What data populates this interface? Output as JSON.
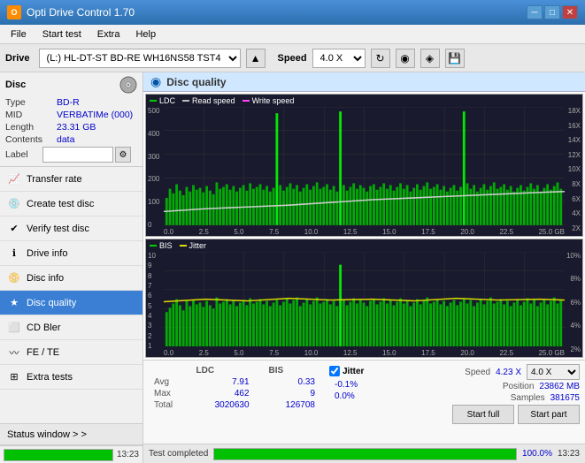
{
  "titlebar": {
    "title": "Opti Drive Control 1.70",
    "icon_label": "O",
    "btn_min": "─",
    "btn_max": "□",
    "btn_close": "✕"
  },
  "menubar": {
    "items": [
      {
        "label": "File"
      },
      {
        "label": "Start test"
      },
      {
        "label": "Extra"
      },
      {
        "label": "Help"
      }
    ]
  },
  "toolbar": {
    "drive_label": "Drive",
    "drive_value": "(L:)  HL-DT-ST BD-RE  WH16NS58 TST4",
    "speed_label": "Speed",
    "speed_value": "4.0 X"
  },
  "disc": {
    "title": "Disc",
    "type_label": "Type",
    "type_value": "BD-R",
    "mid_label": "MID",
    "mid_value": "VERBATIMe (000)",
    "length_label": "Length",
    "length_value": "23.31 GB",
    "contents_label": "Contents",
    "contents_value": "data",
    "label_label": "Label",
    "label_value": ""
  },
  "nav": {
    "items": [
      {
        "id": "transfer-rate",
        "label": "Transfer rate",
        "icon": "chart"
      },
      {
        "id": "create-test-disc",
        "label": "Create test disc",
        "icon": "disc"
      },
      {
        "id": "verify-test-disc",
        "label": "Verify test disc",
        "icon": "check"
      },
      {
        "id": "drive-info",
        "label": "Drive info",
        "icon": "info"
      },
      {
        "id": "disc-info",
        "label": "Disc info",
        "icon": "disc2"
      },
      {
        "id": "disc-quality",
        "label": "Disc quality",
        "icon": "quality",
        "active": true
      },
      {
        "id": "cd-bler",
        "label": "CD Bler",
        "icon": "cd"
      },
      {
        "id": "fe-te",
        "label": "FE / TE",
        "icon": "fe"
      },
      {
        "id": "extra-tests",
        "label": "Extra tests",
        "icon": "extra"
      }
    ]
  },
  "chart": {
    "title": "Disc quality",
    "ldc_legend": "LDC",
    "read_legend": "Read speed",
    "write_legend": "Write speed",
    "bis_legend": "BIS",
    "jitter_legend": "Jitter",
    "x_max": "25.0",
    "y1_max": "500",
    "y2_max": "10",
    "colors": {
      "ldc": "#00aa00",
      "read": "#aaaaaa",
      "write": "#ff00ff",
      "bis": "#00aa00",
      "jitter": "#dddd00",
      "bg": "#1a1a2e"
    }
  },
  "stats": {
    "ldc_label": "LDC",
    "bis_label": "BIS",
    "jitter_label": "Jitter",
    "speed_label": "Speed",
    "position_label": "Position",
    "samples_label": "Samples",
    "avg_label": "Avg",
    "max_label": "Max",
    "total_label": "Total",
    "avg_ldc": "7.91",
    "avg_bis": "0.33",
    "avg_jitter": "-0.1%",
    "max_ldc": "462",
    "max_bis": "9",
    "max_jitter": "0.0%",
    "total_ldc": "3020630",
    "total_bis": "126708",
    "speed_val": "4.23 X",
    "position_val": "23862 MB",
    "samples_val": "381675",
    "speed_select": "4.0 X",
    "btn_start_full": "Start full",
    "btn_start_part": "Start part"
  },
  "statusbar": {
    "status_window_label": "Status window > >",
    "progress": 100,
    "progress_label": "100.0%",
    "time_label": "13:23",
    "status_text": "Test completed"
  }
}
